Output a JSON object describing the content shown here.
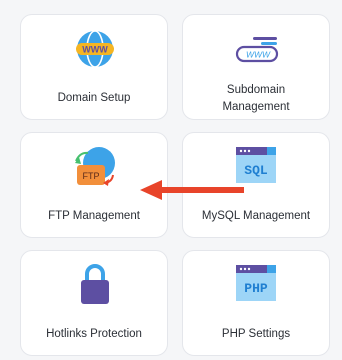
{
  "tiles": [
    {
      "label": "Domain Setup",
      "icon": "globe-www-icon"
    },
    {
      "label_line1": "Subdomain",
      "label_line2": "Management",
      "icon": "subdomain-www-icon"
    },
    {
      "label": "FTP Management",
      "icon": "ftp-folder-icon"
    },
    {
      "label": "MySQL Management",
      "icon": "sql-window-icon",
      "icon_text": "SQL"
    },
    {
      "label": "Hotlinks Protection",
      "icon": "lock-icon"
    },
    {
      "label": "PHP Settings",
      "icon": "php-window-icon",
      "icon_text": "PHP"
    }
  ],
  "icon_texts": {
    "globe": "WWW",
    "subdomain": "WWW",
    "ftp": "FTP"
  },
  "colors": {
    "arrow": "#e8442a",
    "icon_blue": "#3da3e8",
    "icon_orange": "#f28f3b",
    "icon_yellow": "#f5b522",
    "icon_purple": "#5d4fa2",
    "icon_light_blue": "#9dd5f7"
  },
  "annotation": {
    "type": "arrow",
    "points_to": "FTP Management"
  }
}
